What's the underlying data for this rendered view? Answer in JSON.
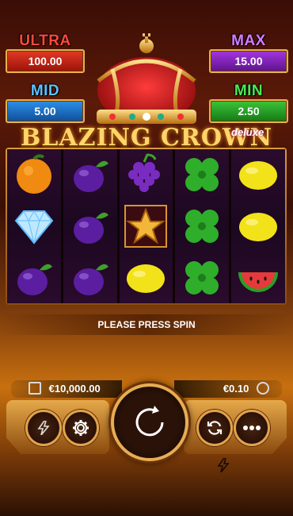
{
  "jackpots": {
    "ultra": {
      "label": "ULTRA",
      "value": "100.00"
    },
    "max": {
      "label": "MAX",
      "value": "15.00"
    },
    "mid": {
      "label": "MID",
      "value": "5.00"
    },
    "min": {
      "label": "MIN",
      "value": "2.50"
    }
  },
  "game": {
    "title": "BLAZING CROWN",
    "edition": "deluxe"
  },
  "reels": [
    [
      "orange-icon",
      "diamond-icon",
      "plum-icon"
    ],
    [
      "plum-icon",
      "plum-icon",
      "plum-icon"
    ],
    [
      "grapes-icon",
      "star-icon",
      "lemon-icon"
    ],
    [
      "clover-icon",
      "clover-icon",
      "clover-icon"
    ],
    [
      "lemon-icon",
      "lemon-icon",
      "watermelon-icon"
    ]
  ],
  "status_message": "PLEASE PRESS SPIN",
  "balance": "€10,000.00",
  "bet": "€0.10",
  "buttons": {
    "turbo": "lightning-icon",
    "settings": "gear-icon",
    "spin": "spin-arrow-icon",
    "autoplay": "autoplay-icon",
    "menu": "more-icon",
    "quick_spin": "lightning-icon"
  },
  "colors": {
    "ultra": "#e13a26",
    "max": "#a436e0",
    "mid": "#2e8fe6",
    "min": "#3ec43a",
    "gold": "#e7ad54"
  }
}
